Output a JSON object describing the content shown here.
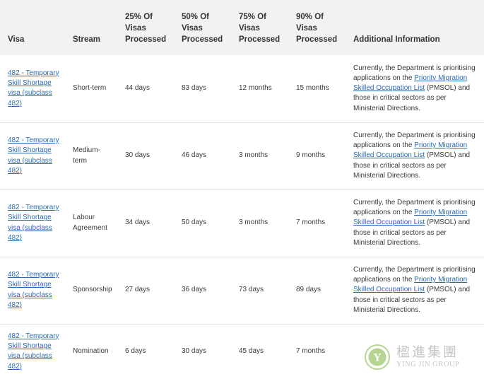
{
  "table": {
    "headers": {
      "visa": "Visa",
      "stream": "Stream",
      "p25": "25% Of Visas Processed",
      "p50": "50% Of Visas Processed",
      "p75": "75% Of Visas Processed",
      "p90": "90% Of Visas Processed",
      "info": "Additional Information"
    },
    "rows": [
      {
        "visa": "482 - Temporary Skill Shortage visa (subclass 482)",
        "stream": "Short-term",
        "p25": "44 days",
        "p50": "83 days",
        "p75": "12 months",
        "p90": "15 months",
        "info_pre": "Currently, the Department is prioritising applications on the ",
        "info_link": "Priority Migration Skilled Occupation List",
        "info_post": " (PMSOL) and those in critical sectors as per Ministerial Directions."
      },
      {
        "visa": "482 - Temporary Skill Shortage visa (subclass 482)",
        "stream": "Medium-term",
        "p25": "30 days",
        "p50": "46 days",
        "p75": "3 months",
        "p90": "9 months",
        "info_pre": "Currently, the Department is prioritising applications on the ",
        "info_link": "Priority Migration Skilled Occupation List",
        "info_post": " (PMSOL) and those in critical sectors as per Ministerial Directions."
      },
      {
        "visa": "482 - Temporary Skill Shortage visa (subclass 482)",
        "stream": "Labour Agreement",
        "p25": "34 days",
        "p50": "50 days",
        "p75": "3 months",
        "p90": "7 months",
        "info_pre": "Currently, the Department is prioritising applications on the ",
        "info_link": "Priority Migration Skilled Occupation List",
        "info_post": " (PMSOL) and those in critical sectors as per Ministerial Directions."
      },
      {
        "visa": "482 - Temporary Skill Shortage visa (subclass 482)",
        "stream": "Sponsorship",
        "p25": "27 days",
        "p50": "36 days",
        "p75": "73 days",
        "p90": "89 days",
        "info_pre": "Currently, the Department is prioritising applications on the ",
        "info_link": "Priority Migration Skilled Occupation List",
        "info_post": " (PMSOL) and those in critical sectors as per Ministerial Directions."
      },
      {
        "visa": "482 - Temporary Skill Shortage visa (subclass 482)",
        "stream": "Nomination",
        "p25": "6 days",
        "p50": "30 days",
        "p75": "45 days",
        "p90": "7 months",
        "info_pre": "",
        "info_link": "",
        "info_post": ""
      }
    ]
  },
  "watermark": {
    "name_cn": "楹進集團",
    "name_en": "YING JIN GROUP",
    "logo_glyph": "Y"
  },
  "colors": {
    "link": "#2a6ab5",
    "header_bg": "#f2f2f2",
    "logo_green": "#7bb33a"
  }
}
